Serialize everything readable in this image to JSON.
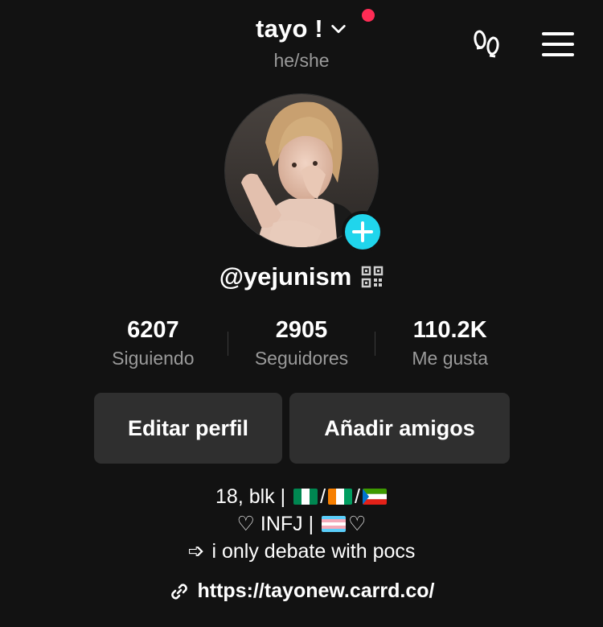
{
  "header": {
    "username": "tayo !",
    "pronouns": "he/she",
    "notification_color": "#fe2c55",
    "footprints_icon": "footprints-icon",
    "menu_icon": "hamburger-menu-icon"
  },
  "profile": {
    "handle": "@yejunism",
    "add_button_color": "#20d5ec"
  },
  "stats": [
    {
      "value": "6207",
      "label": "Siguiendo"
    },
    {
      "value": "2905",
      "label": "Seguidores"
    },
    {
      "value": "110.2K",
      "label": "Me gusta"
    }
  ],
  "actions": {
    "edit_label": "Editar perfil",
    "add_friends_label": "Añadir amigos"
  },
  "bio": {
    "line1_prefix": "18, blk | ",
    "line1_flags": [
      "nigeria-flag",
      "ivory-coast-flag",
      "equatorial-guinea-flag"
    ],
    "line1_separator": "/",
    "line2_prefix": "♡ INFJ | ",
    "line2_flag": "transgender-flag",
    "line2_suffix": "♡",
    "line3_arrow": "➩",
    "line3_text": " i only debate with pocs"
  },
  "link": {
    "url": "https://tayonew.carrd.co/"
  }
}
